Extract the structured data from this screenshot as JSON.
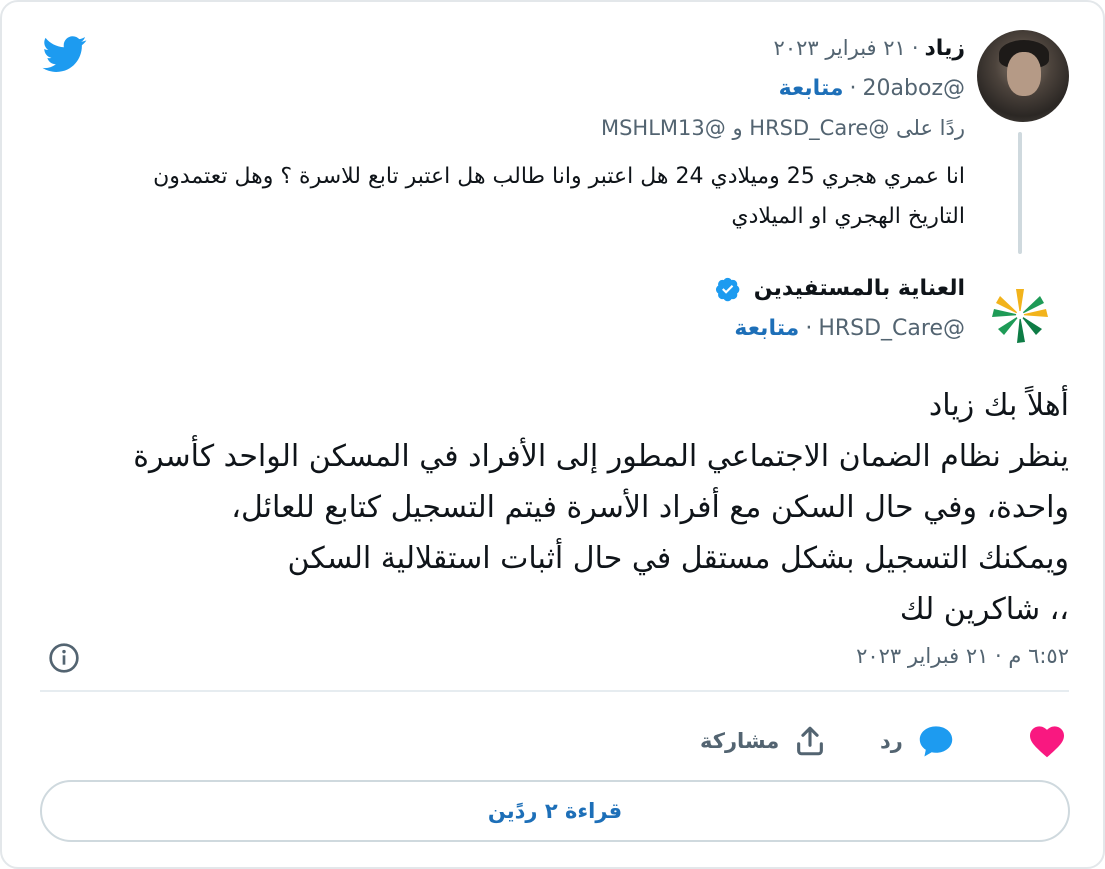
{
  "reply_tweet": {
    "author_name": "زياد",
    "date": "٢١ فبراير ٢٠٢٣",
    "handle": "@20aboz",
    "follow_label": "متابعة",
    "replying_to_prefix": "ردًا على",
    "replying_to_user1": "@HRSD_Care",
    "replying_to_and": "و",
    "replying_to_user2": "@MSHLM13",
    "text": "انا عمري هجري 25 وميلادي 24 هل اعتبر وانا طالب هل اعتبر تابع للاسرة ؟ وهل تعتمدون التاريخ الهجري او الميلادي"
  },
  "main_tweet": {
    "author_name": "العناية بالمستفيدين",
    "handle": "@HRSD_Care",
    "follow_label": "متابعة",
    "text_lines": [
      "أهلاً بك زياد",
      "ينظر نظام الضمان الاجتماعي المطور إلى الأفراد في المسكن الواحد كأسرة",
      "واحدة، وفي حال السكن مع أفراد الأسرة فيتم التسجيل كتابع للعائل،",
      "ويمكنك التسجيل بشكل مستقل في حال أثبات استقلالية السكن",
      "،، شاكرين لك"
    ],
    "timestamp": "٦:٥٢ م · ٢١ فبراير ٢٠٢٣"
  },
  "actions": {
    "reply_label": "رد",
    "share_label": "مشاركة"
  },
  "read_replies_label": "قراءة ٢ ردًين",
  "icons": {
    "brand": "twitter-bird-icon",
    "verified": "verified-badge-icon",
    "info": "info-icon",
    "like": "heart-icon",
    "reply": "speech-bubble-icon",
    "share": "share-upload-icon"
  },
  "colors": {
    "twitter_blue": "#1d9bf0",
    "like_pink": "#f91880",
    "link_blue": "#1d6fb8",
    "muted_gray": "#536471"
  }
}
